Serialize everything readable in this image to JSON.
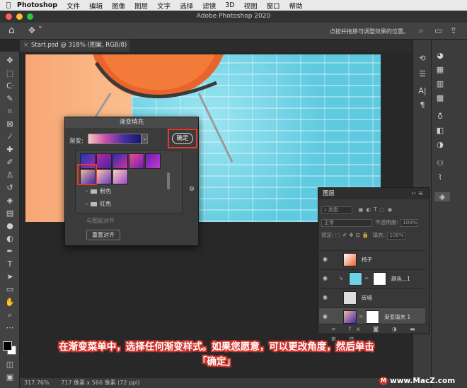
{
  "menubar": {
    "apple": "",
    "app_name": "Photoshop",
    "items": [
      "文件",
      "编辑",
      "图像",
      "图层",
      "文字",
      "选择",
      "滤镜",
      "3D",
      "视图",
      "窗口",
      "帮助"
    ]
  },
  "window": {
    "title": "Adobe Photoshop 2020"
  },
  "options_bar": {
    "hint": "点按并拖移可调整效果的位置。"
  },
  "document_tab": {
    "label": "Start.psd @ 318% (图案, RGB/8) *"
  },
  "gradient_dialog": {
    "title": "渐变填充",
    "gradient_label": "渐变:",
    "ok_label": "确定",
    "folders": [
      "粉色",
      "红色"
    ],
    "align_hint": "与图层对齐",
    "reset_align_label": "重置对齐"
  },
  "layers_panel": {
    "title": "图层",
    "kind_filter": "类型",
    "blend_mode": "正常",
    "opacity_label": "不透明度:",
    "opacity_value": "100%",
    "lock_label": "锁定:",
    "fill_label": "填充:",
    "fill_value": "100%",
    "layers": [
      {
        "name": "椅子",
        "selected": false
      },
      {
        "name": "颜色...1",
        "selected": false
      },
      {
        "name": "砖墙",
        "selected": false
      },
      {
        "name": "渐变填充 1",
        "selected": true
      }
    ]
  },
  "status_bar": {
    "zoom": "317.76%",
    "doc_size": "717 像素 x 566 像素 (72 ppi)"
  },
  "caption": {
    "line1": "在渐变菜单中，选择任何渐变样式。如果您愿意，可以更改角度，然后单击",
    "line2": "「确定」"
  },
  "watermark": "www.MacZ.com",
  "colors": {
    "highlight_red": "#e03c2c",
    "wall_cyan": "#6fd3e6",
    "peach": "#f7a674"
  }
}
